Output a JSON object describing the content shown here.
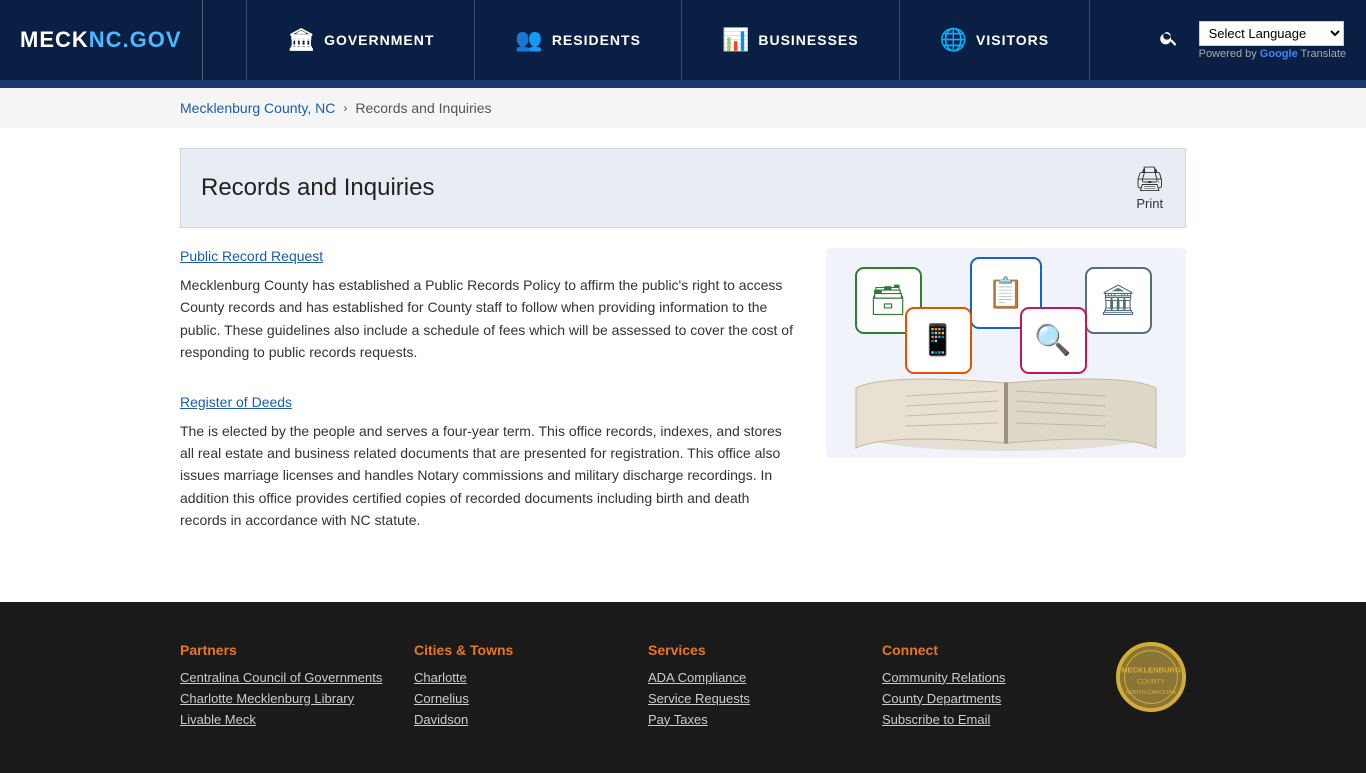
{
  "header": {
    "logo": {
      "meck": "MECK",
      "nc": "NC.GOV"
    },
    "nav": [
      {
        "label": "GOVERNMENT",
        "icon": "🏛"
      },
      {
        "label": "RESIDENTS",
        "icon": "👥"
      },
      {
        "label": "BUSINESSES",
        "icon": "📊"
      },
      {
        "label": "VISITORS",
        "icon": "🌐"
      }
    ],
    "translate": {
      "select_label": "Select Language",
      "powered_by": "Powered by",
      "google": "Google",
      "translate": "Translate"
    }
  },
  "breadcrumb": {
    "home": "Mecklenburg County, NC",
    "current": "Records and Inquiries"
  },
  "page": {
    "title": "Records and Inquiries",
    "print_label": "Print",
    "sections": [
      {
        "link_text": "Public Record Request",
        "body": "Mecklenburg County has established a Public Records Policy to affirm the public's right to access County records and has established for County staff to follow when providing information to the public. These guidelines also include a schedule of fees which will be assessed to cover the cost of responding to public records requests."
      },
      {
        "link_text": "Register of Deeds",
        "body": "The is elected by the people and serves a four-year term. This office records, indexes, and stores all real estate and business related documents that are presented for registration. This office also issues marriage licenses and handles Notary commissions and military discharge recordings. In addition this office provides certified copies of recorded documents including birth and death records in accordance with NC statute."
      }
    ]
  },
  "footer": {
    "columns": [
      {
        "heading": "Partners",
        "links": [
          "Centralina Council of Governments",
          "Charlotte Mecklenburg Library",
          "Livable Meck"
        ]
      },
      {
        "heading": "Cities & Towns",
        "links": [
          "Charlotte",
          "Cornelius",
          "Davidson"
        ]
      },
      {
        "heading": "Services",
        "links": [
          "ADA Compliance",
          "Service Requests",
          "Pay Taxes"
        ]
      },
      {
        "heading": "Connect",
        "links": [
          "Community Relations",
          "County Departments",
          "Subscribe to Email"
        ]
      }
    ]
  }
}
